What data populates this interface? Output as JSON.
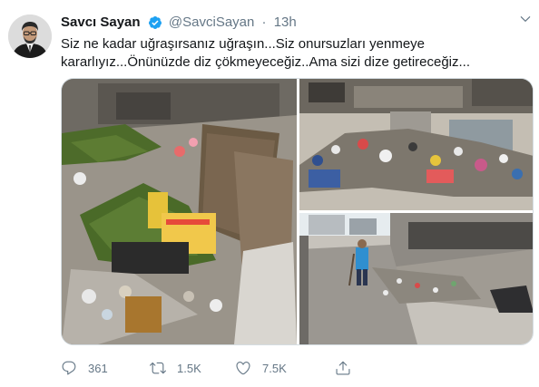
{
  "tweet": {
    "author_name": "Savcı Sayan",
    "handle": "@SavciSayan",
    "separator": "·",
    "time": "13h",
    "text": "Siz ne kadar uğraşırsanız uğraşın...Siz onursuzları yenmeye kararlıyız...Önünüzde diz çökmeyeceğiz..Ama sizi dize getireceğiz...",
    "verified": true
  },
  "actions": {
    "replies": "361",
    "retweets": "1.5K",
    "likes": "7.5K"
  },
  "colors": {
    "text": "#14171a",
    "muted": "#657786",
    "verified_blue": "#1da1f2",
    "border": "#d5dde2"
  },
  "icons": [
    "verified-badge-icon",
    "chevron-down-icon",
    "reply-icon",
    "retweet-icon",
    "like-icon",
    "share-icon"
  ]
}
